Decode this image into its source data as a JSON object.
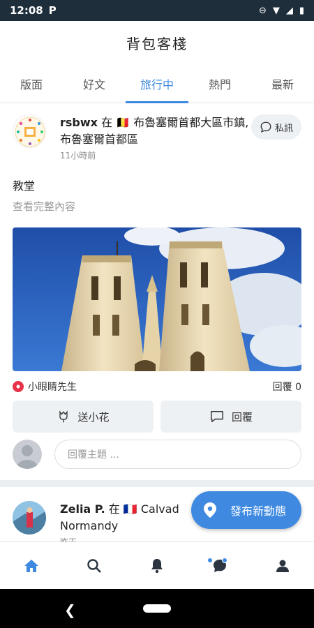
{
  "status_bar": {
    "time": "12:08",
    "app_indicator": "P"
  },
  "header": {
    "title": "背包客棧"
  },
  "tabs": [
    {
      "label": "版面",
      "active": false
    },
    {
      "label": "好文",
      "active": false
    },
    {
      "label": "旅行中",
      "active": true
    },
    {
      "label": "熱門",
      "active": false
    },
    {
      "label": "最新",
      "active": false
    }
  ],
  "post1": {
    "author": "rsbwx",
    "at": "在",
    "flag": "🇧🇪",
    "location": "布魯塞爾首都大區市鎮, 布魯塞爾首都區",
    "time": "11小時前",
    "dm_label": "私訊",
    "title": "教堂",
    "read_more": "查看完整內容",
    "flower_giver": "小眼睛先生",
    "reply_count": "回覆 0",
    "send_flower_label": "送小花",
    "reply_label": "回覆",
    "comment_placeholder": "回覆主題 ..."
  },
  "post2": {
    "author": "Zelia P.",
    "at": "在",
    "flag": "🇫🇷",
    "location": "Calvados, Normandy",
    "location_visible_line1": "Calvad",
    "location_visible_line2": "Normandy",
    "time": "昨天"
  },
  "fab": {
    "label": "發布新動態"
  },
  "bottom_nav": [
    "home-icon",
    "search-icon",
    "bell-icon",
    "chat-icon",
    "profile-icon"
  ],
  "colors": {
    "accent": "#3f8ae0",
    "flower": "#e8334a"
  }
}
